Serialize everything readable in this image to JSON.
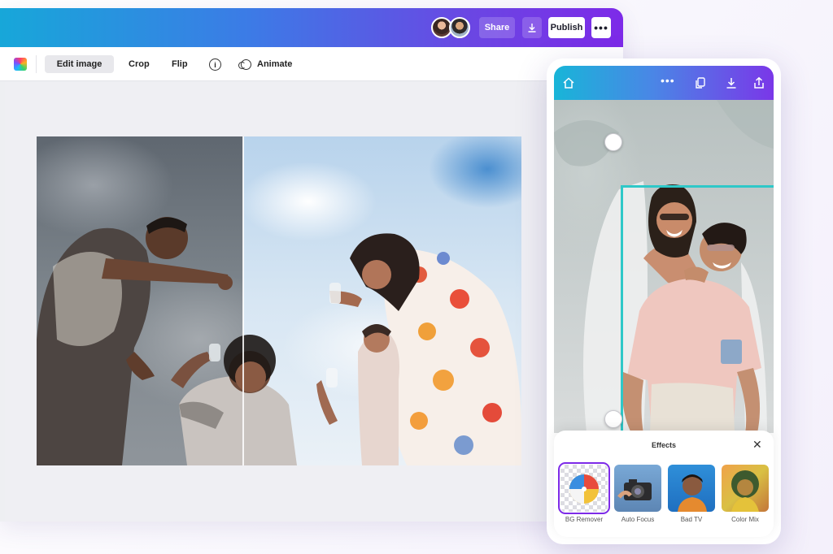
{
  "editor": {
    "topbar": {
      "share_label": "Share",
      "download_icon": "download-icon",
      "publish_label": "Publish",
      "more_label": "•••",
      "avatars": [
        "user-avatar",
        "user-avatar"
      ]
    },
    "toolbar": {
      "color_icon": "color-swatch-icon",
      "edit_image_label": "Edit image",
      "crop_label": "Crop",
      "flip_label": "Flip",
      "info_label": "i",
      "animate_label": "Animate"
    }
  },
  "phone": {
    "bar_icons": [
      "home-icon",
      "more-icon",
      "copy-icon",
      "download-icon",
      "share-icon"
    ],
    "effects": {
      "title": "Effects",
      "close_label": "✕",
      "items": [
        {
          "label": "BG Remover",
          "selected": true
        },
        {
          "label": "Auto Focus",
          "selected": false
        },
        {
          "label": "Bad TV",
          "selected": false
        },
        {
          "label": "Color Mix",
          "selected": false
        }
      ]
    }
  },
  "colors": {
    "brand_gradient_start": "#17a7d9",
    "brand_gradient_end": "#7d2ae8",
    "selection_color": "#2ec8c8",
    "selected_effect_outline": "#7d2ae8"
  }
}
